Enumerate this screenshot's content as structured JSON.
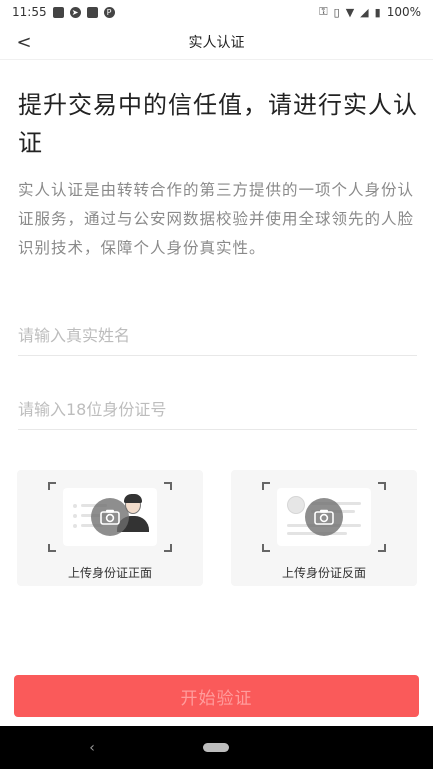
{
  "status_bar": {
    "time": "11:55",
    "left_icons": [
      "image-icon",
      "telegram-icon",
      "instagram-icon",
      "p-icon"
    ],
    "battery": "100%"
  },
  "nav": {
    "title": "实人认证",
    "back_glyph": "<"
  },
  "headline": "提升交易中的信任值，请进行实人认证",
  "description": "实人认证是由转转合作的第三方提供的一项个人身份认证服务，通过与公安网数据校验并使用全球领先的人脸识别技术，保障个人身份真实性。",
  "form": {
    "name_placeholder": "请输入真实姓名",
    "name_value": "",
    "id_placeholder": "请输入18位身份证号",
    "id_value": ""
  },
  "upload": {
    "front_label": "上传身份证正面",
    "back_label": "上传身份证反面"
  },
  "submit": {
    "label": "开始验证"
  },
  "colors": {
    "accent": "#fa5a5a",
    "button_text_disabled": "#ff9c9c",
    "muted_text": "#8a8a8a"
  },
  "android_nav": {
    "back_glyph": "‹"
  }
}
